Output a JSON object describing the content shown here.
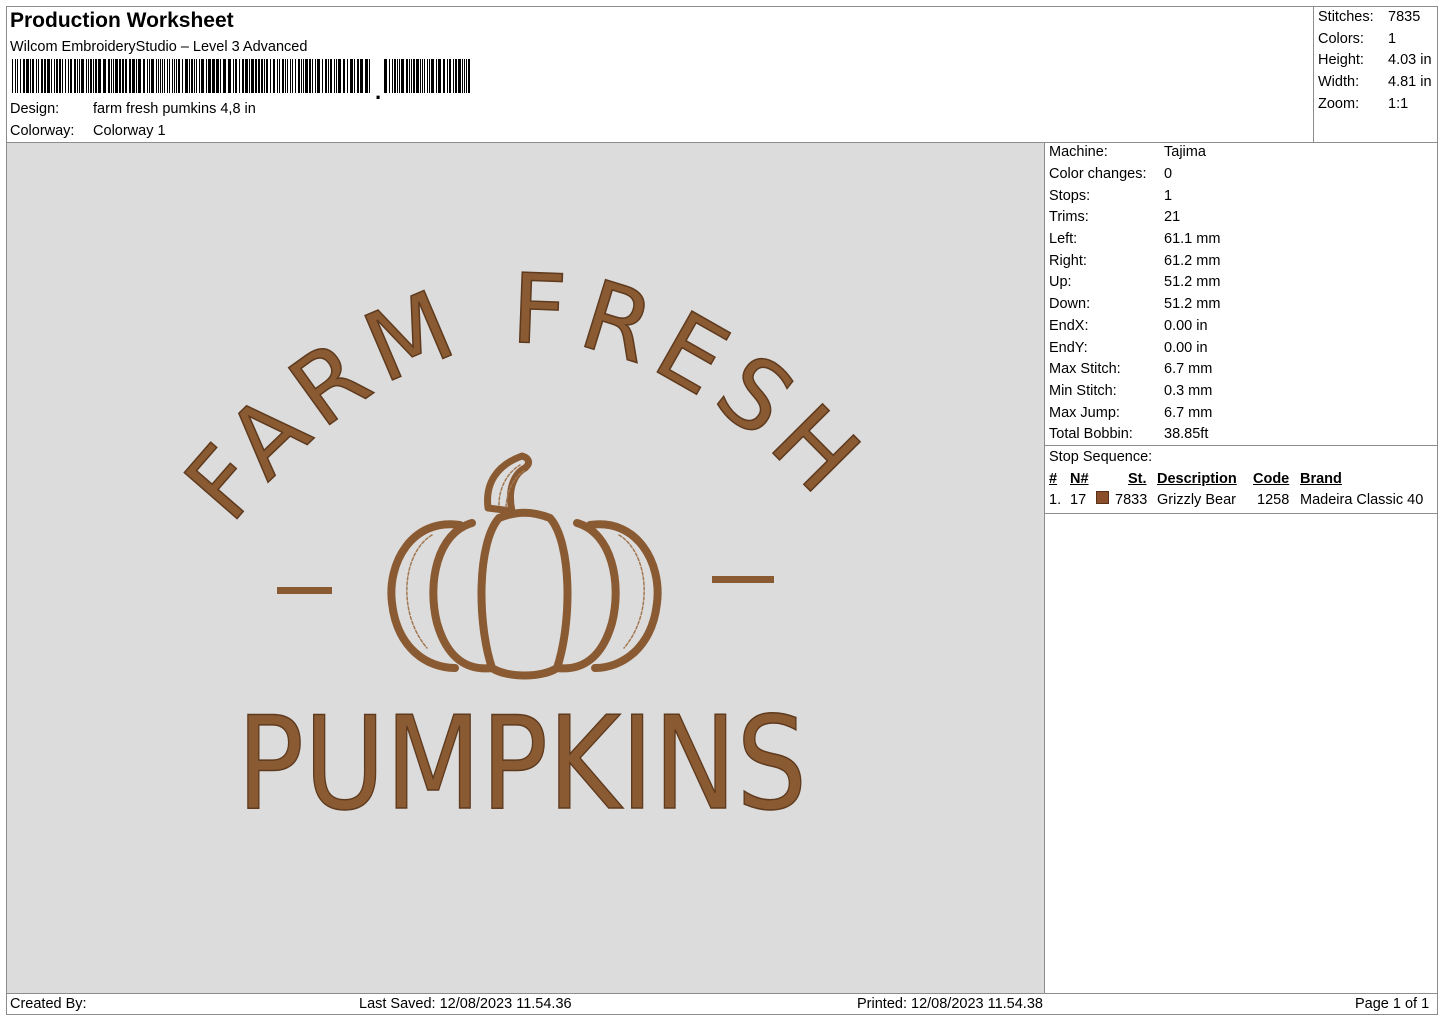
{
  "header": {
    "title": "Production Worksheet",
    "software": "Wilcom EmbroideryStudio – Level 3 Advanced",
    "design_label": "Design:",
    "design_value": "farm fresh pumkins 4,8 in",
    "colorway_label": "Colorway:",
    "colorway_value": "Colorway 1"
  },
  "stats": [
    {
      "label": "Stitches:",
      "value": "7835"
    },
    {
      "label": "Colors:",
      "value": "1"
    },
    {
      "label": "Height:",
      "value": "4.03 in"
    },
    {
      "label": "Width:",
      "value": "4.81 in"
    },
    {
      "label": "Zoom:",
      "value": "1:1"
    }
  ],
  "machine_info": [
    {
      "label": "Machine:",
      "value": "Tajima"
    },
    {
      "label": "Color changes:",
      "value": "0"
    },
    {
      "label": "Stops:",
      "value": "1"
    },
    {
      "label": "Trims:",
      "value": "21"
    },
    {
      "label": "Left:",
      "value": "61.1 mm"
    },
    {
      "label": "Right:",
      "value": "61.2 mm"
    },
    {
      "label": "Up:",
      "value": "51.2 mm"
    },
    {
      "label": "Down:",
      "value": "51.2 mm"
    },
    {
      "label": "EndX:",
      "value": "0.00 in"
    },
    {
      "label": "EndY:",
      "value": "0.00 in"
    },
    {
      "label": "Max Stitch:",
      "value": "6.7 mm"
    },
    {
      "label": "Min Stitch:",
      "value": "0.3 mm"
    },
    {
      "label": "Max Jump:",
      "value": "6.7 mm"
    },
    {
      "label": "Total Bobbin:",
      "value": "38.85ft"
    }
  ],
  "stop_sequence": {
    "caption": "Stop Sequence:",
    "headers": {
      "num": "#",
      "n": "N#",
      "st": "St.",
      "description": "Description",
      "code": "Code",
      "brand": "Brand"
    },
    "rows": [
      {
        "num": "1.",
        "n": "17",
        "color": "#8a4e2a",
        "st": "7833",
        "description": "Grizzly Bear",
        "code": "1258",
        "brand": "Madeira Classic 40"
      }
    ]
  },
  "design": {
    "top_text": "FARM FRESH",
    "bottom_text": "PUMPKINS",
    "thread_color": "#8a5a32",
    "background_color": "#dcdcdc"
  },
  "footer": {
    "created_by": "Created By:",
    "last_saved": "Last Saved: 12/08/2023 11.54.36",
    "printed": "Printed: 12/08/2023 11.54.38",
    "page": "Page 1 of 1"
  }
}
